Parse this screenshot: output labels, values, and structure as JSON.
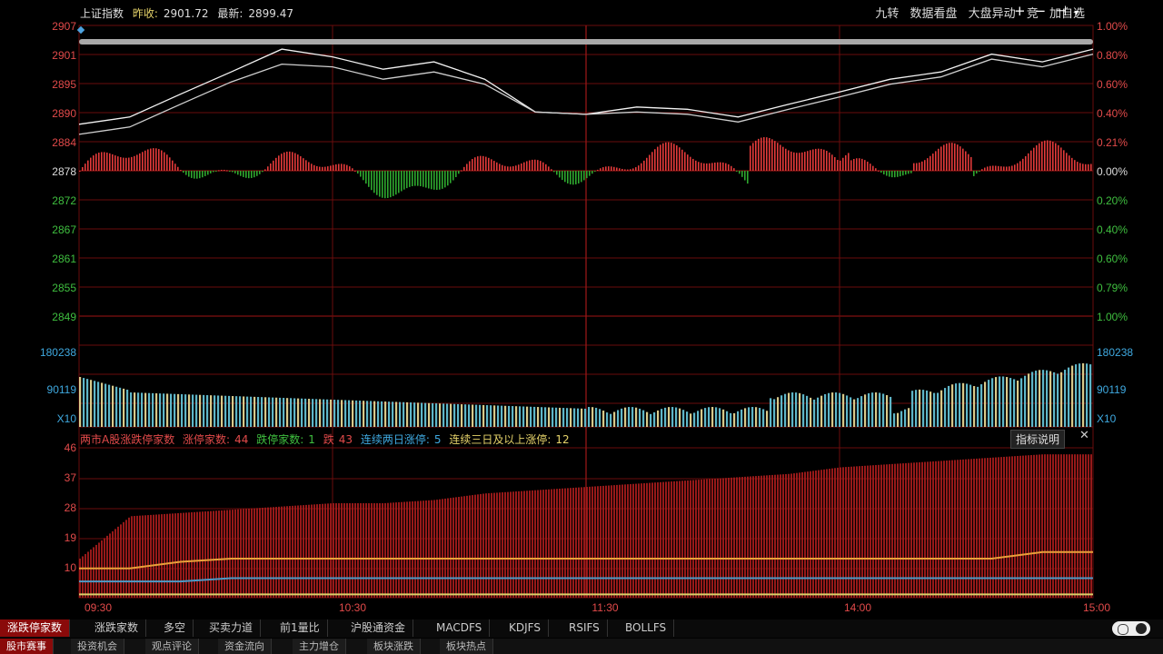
{
  "colors": {
    "up": "#e23a3a",
    "down": "#2ea82e",
    "grid": "#6a0d0d",
    "axis_red": "#e24a4a",
    "axis_green": "#3fbf3f",
    "axis_blue": "#3fa9e0",
    "vol_yellow": "#d8c98a",
    "vol_cyan": "#5fb6c8",
    "ind_bar": "#a61c1c",
    "ind_line1": "#e9a13a",
    "ind_line2": "#4d9ac6"
  },
  "header": {
    "title": "上证指数",
    "close_label": "昨收:",
    "close_value": "2901.72",
    "latest_label": "最新:",
    "latest_value": "2899.47",
    "tools": [
      "九转",
      "数据看盘",
      "大盘异动",
      "竞",
      "加自选"
    ],
    "icons": [
      "plus-icon",
      "minus-icon",
      "pin-icon",
      "chevron-down-icon"
    ]
  },
  "price_axis_left": [
    "2907",
    "2901",
    "2895",
    "2890",
    "2884",
    "2878",
    "2872",
    "2867",
    "2861",
    "2855",
    "2849"
  ],
  "price_axis_right": [
    "1.00%",
    "0.80%",
    "0.60%",
    "0.40%",
    "0.21%",
    "0.00%",
    "0.20%",
    "0.40%",
    "0.60%",
    "0.79%",
    "1.00%"
  ],
  "volume_axis_left": [
    "180238",
    "90119",
    "X10"
  ],
  "volume_axis_right": [
    "180238",
    "90119",
    "X10"
  ],
  "indicator_legend": {
    "prefix": "两市A股涨跌停家数",
    "up_label": "涨停家数:",
    "up_value": "44",
    "down_label": "跌停家数:",
    "down_value": "1",
    "mid_label": "跌",
    "mid_value": "43",
    "two_day_label": "连续两日涨停:",
    "two_day_value": "5",
    "three_day_label": "连续三日及以上涨停:",
    "three_day_value": "12",
    "help": "指标说明"
  },
  "indicator_axis_left": [
    "46",
    "37",
    "28",
    "19",
    "10"
  ],
  "time_axis": [
    "09:30",
    "10:30",
    "11:30",
    "14:00",
    "15:00"
  ],
  "tabs_row1": [
    "涨跌停家数",
    "涨跌家数",
    "多空",
    "买卖力道",
    "前1量比",
    "沪股通资金",
    "MACDFS",
    "KDJFS",
    "RSIFS",
    "BOLLFS"
  ],
  "tabs_row2": [
    "股市赛事",
    "投资机会",
    "观点评论",
    "资金流向",
    "主力增仓",
    "板块涨跌",
    "板块热点"
  ],
  "chart_data": {
    "type": "line",
    "price_range": [
      2849,
      2907
    ],
    "prev_close": 2878,
    "index_series_points": [
      2887,
      2889,
      2893,
      2898,
      2902,
      2901,
      2898,
      2900,
      2896,
      2890,
      2889,
      2891,
      2890,
      2889,
      2891,
      2894,
      2896,
      2898,
      2901,
      2900,
      2902
    ],
    "avg_series_points": [
      2885,
      2887,
      2891,
      2896,
      2899,
      2899,
      2896,
      2898,
      2895,
      2890,
      2889,
      2890,
      2889,
      2888,
      2890,
      2893,
      2895,
      2897,
      2900,
      2899,
      2901
    ],
    "limit_up_count_points": [
      12,
      25,
      26,
      27,
      28,
      29,
      29,
      30,
      32,
      33,
      34,
      35,
      36,
      37,
      38,
      40,
      41,
      42,
      43,
      44,
      44
    ],
    "limit_down_count_points": [
      1,
      1,
      1,
      1,
      1,
      1,
      1,
      1,
      1,
      1,
      1,
      1,
      1,
      1,
      1,
      1,
      1,
      1,
      1,
      1,
      1
    ]
  }
}
